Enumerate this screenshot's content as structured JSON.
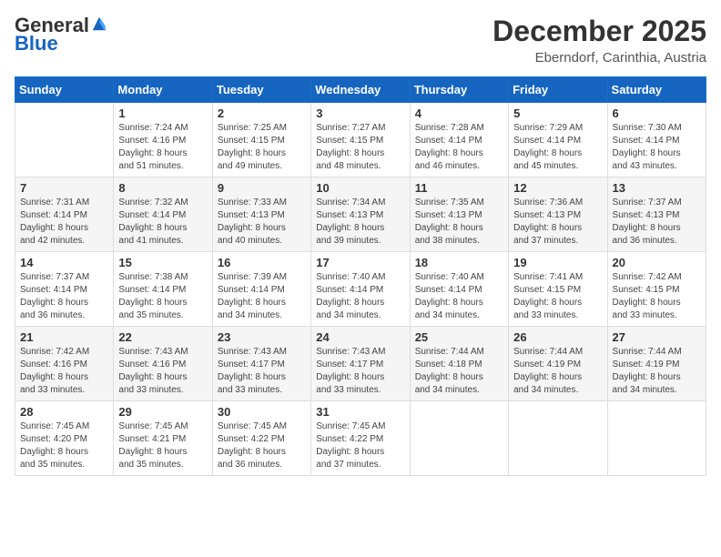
{
  "header": {
    "logo_general": "General",
    "logo_blue": "Blue",
    "month_title": "December 2025",
    "location": "Eberndorf, Carinthia, Austria"
  },
  "days_of_week": [
    "Sunday",
    "Monday",
    "Tuesday",
    "Wednesday",
    "Thursday",
    "Friday",
    "Saturday"
  ],
  "weeks": [
    [
      {
        "day": "",
        "info": ""
      },
      {
        "day": "1",
        "info": "Sunrise: 7:24 AM\nSunset: 4:16 PM\nDaylight: 8 hours\nand 51 minutes."
      },
      {
        "day": "2",
        "info": "Sunrise: 7:25 AM\nSunset: 4:15 PM\nDaylight: 8 hours\nand 49 minutes."
      },
      {
        "day": "3",
        "info": "Sunrise: 7:27 AM\nSunset: 4:15 PM\nDaylight: 8 hours\nand 48 minutes."
      },
      {
        "day": "4",
        "info": "Sunrise: 7:28 AM\nSunset: 4:14 PM\nDaylight: 8 hours\nand 46 minutes."
      },
      {
        "day": "5",
        "info": "Sunrise: 7:29 AM\nSunset: 4:14 PM\nDaylight: 8 hours\nand 45 minutes."
      },
      {
        "day": "6",
        "info": "Sunrise: 7:30 AM\nSunset: 4:14 PM\nDaylight: 8 hours\nand 43 minutes."
      }
    ],
    [
      {
        "day": "7",
        "info": "Sunrise: 7:31 AM\nSunset: 4:14 PM\nDaylight: 8 hours\nand 42 minutes."
      },
      {
        "day": "8",
        "info": "Sunrise: 7:32 AM\nSunset: 4:14 PM\nDaylight: 8 hours\nand 41 minutes."
      },
      {
        "day": "9",
        "info": "Sunrise: 7:33 AM\nSunset: 4:13 PM\nDaylight: 8 hours\nand 40 minutes."
      },
      {
        "day": "10",
        "info": "Sunrise: 7:34 AM\nSunset: 4:13 PM\nDaylight: 8 hours\nand 39 minutes."
      },
      {
        "day": "11",
        "info": "Sunrise: 7:35 AM\nSunset: 4:13 PM\nDaylight: 8 hours\nand 38 minutes."
      },
      {
        "day": "12",
        "info": "Sunrise: 7:36 AM\nSunset: 4:13 PM\nDaylight: 8 hours\nand 37 minutes."
      },
      {
        "day": "13",
        "info": "Sunrise: 7:37 AM\nSunset: 4:13 PM\nDaylight: 8 hours\nand 36 minutes."
      }
    ],
    [
      {
        "day": "14",
        "info": "Sunrise: 7:37 AM\nSunset: 4:14 PM\nDaylight: 8 hours\nand 36 minutes."
      },
      {
        "day": "15",
        "info": "Sunrise: 7:38 AM\nSunset: 4:14 PM\nDaylight: 8 hours\nand 35 minutes."
      },
      {
        "day": "16",
        "info": "Sunrise: 7:39 AM\nSunset: 4:14 PM\nDaylight: 8 hours\nand 34 minutes."
      },
      {
        "day": "17",
        "info": "Sunrise: 7:40 AM\nSunset: 4:14 PM\nDaylight: 8 hours\nand 34 minutes."
      },
      {
        "day": "18",
        "info": "Sunrise: 7:40 AM\nSunset: 4:14 PM\nDaylight: 8 hours\nand 34 minutes."
      },
      {
        "day": "19",
        "info": "Sunrise: 7:41 AM\nSunset: 4:15 PM\nDaylight: 8 hours\nand 33 minutes."
      },
      {
        "day": "20",
        "info": "Sunrise: 7:42 AM\nSunset: 4:15 PM\nDaylight: 8 hours\nand 33 minutes."
      }
    ],
    [
      {
        "day": "21",
        "info": "Sunrise: 7:42 AM\nSunset: 4:16 PM\nDaylight: 8 hours\nand 33 minutes."
      },
      {
        "day": "22",
        "info": "Sunrise: 7:43 AM\nSunset: 4:16 PM\nDaylight: 8 hours\nand 33 minutes."
      },
      {
        "day": "23",
        "info": "Sunrise: 7:43 AM\nSunset: 4:17 PM\nDaylight: 8 hours\nand 33 minutes."
      },
      {
        "day": "24",
        "info": "Sunrise: 7:43 AM\nSunset: 4:17 PM\nDaylight: 8 hours\nand 33 minutes."
      },
      {
        "day": "25",
        "info": "Sunrise: 7:44 AM\nSunset: 4:18 PM\nDaylight: 8 hours\nand 34 minutes."
      },
      {
        "day": "26",
        "info": "Sunrise: 7:44 AM\nSunset: 4:19 PM\nDaylight: 8 hours\nand 34 minutes."
      },
      {
        "day": "27",
        "info": "Sunrise: 7:44 AM\nSunset: 4:19 PM\nDaylight: 8 hours\nand 34 minutes."
      }
    ],
    [
      {
        "day": "28",
        "info": "Sunrise: 7:45 AM\nSunset: 4:20 PM\nDaylight: 8 hours\nand 35 minutes."
      },
      {
        "day": "29",
        "info": "Sunrise: 7:45 AM\nSunset: 4:21 PM\nDaylight: 8 hours\nand 35 minutes."
      },
      {
        "day": "30",
        "info": "Sunrise: 7:45 AM\nSunset: 4:22 PM\nDaylight: 8 hours\nand 36 minutes."
      },
      {
        "day": "31",
        "info": "Sunrise: 7:45 AM\nSunset: 4:22 PM\nDaylight: 8 hours\nand 37 minutes."
      },
      {
        "day": "",
        "info": ""
      },
      {
        "day": "",
        "info": ""
      },
      {
        "day": "",
        "info": ""
      }
    ]
  ]
}
